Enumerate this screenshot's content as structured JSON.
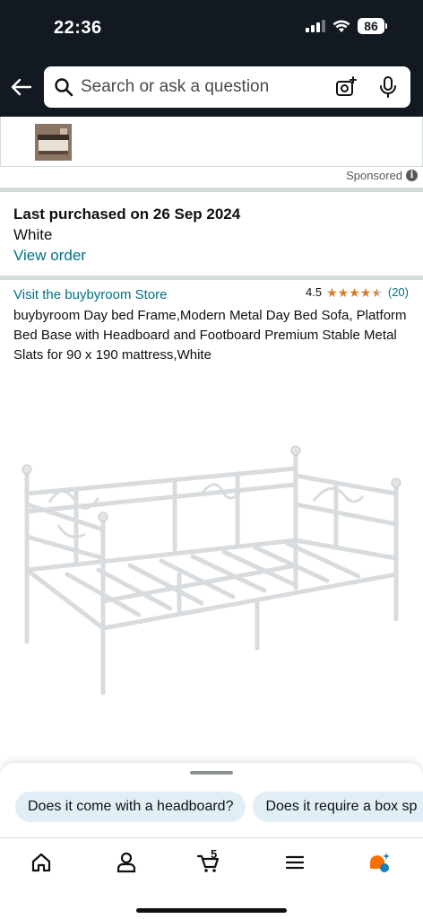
{
  "status_bar": {
    "time": "22:36",
    "battery": "86"
  },
  "search": {
    "placeholder": "Search or ask a question"
  },
  "ad": {
    "sponsored_label": "Sponsored"
  },
  "purchase": {
    "title": "Last purchased on 26 Sep 2024",
    "color": "White",
    "view_order": "View order"
  },
  "product": {
    "store_link": "Visit the buybyroom Store",
    "rating_value": "4.5",
    "rating_count": "(20)",
    "stars": 4.5,
    "title": "buybyroom Day bed Frame,Modern Metal Day Bed Sofa, Platform Bed Base with Headboard and Footboard Premium Stable Metal Slats for 90 x 190 mattress,White"
  },
  "suggestions": [
    "Does it come with a headboard?",
    "Does it require a box sp"
  ],
  "nav": {
    "cart_count": "5",
    "items": [
      "home-icon",
      "account-icon",
      "cart-icon",
      "menu-icon",
      "rufus-icon"
    ]
  },
  "colors": {
    "header": "#131921",
    "link": "#007185",
    "star": "#de7921",
    "chip": "#e1eef6"
  }
}
